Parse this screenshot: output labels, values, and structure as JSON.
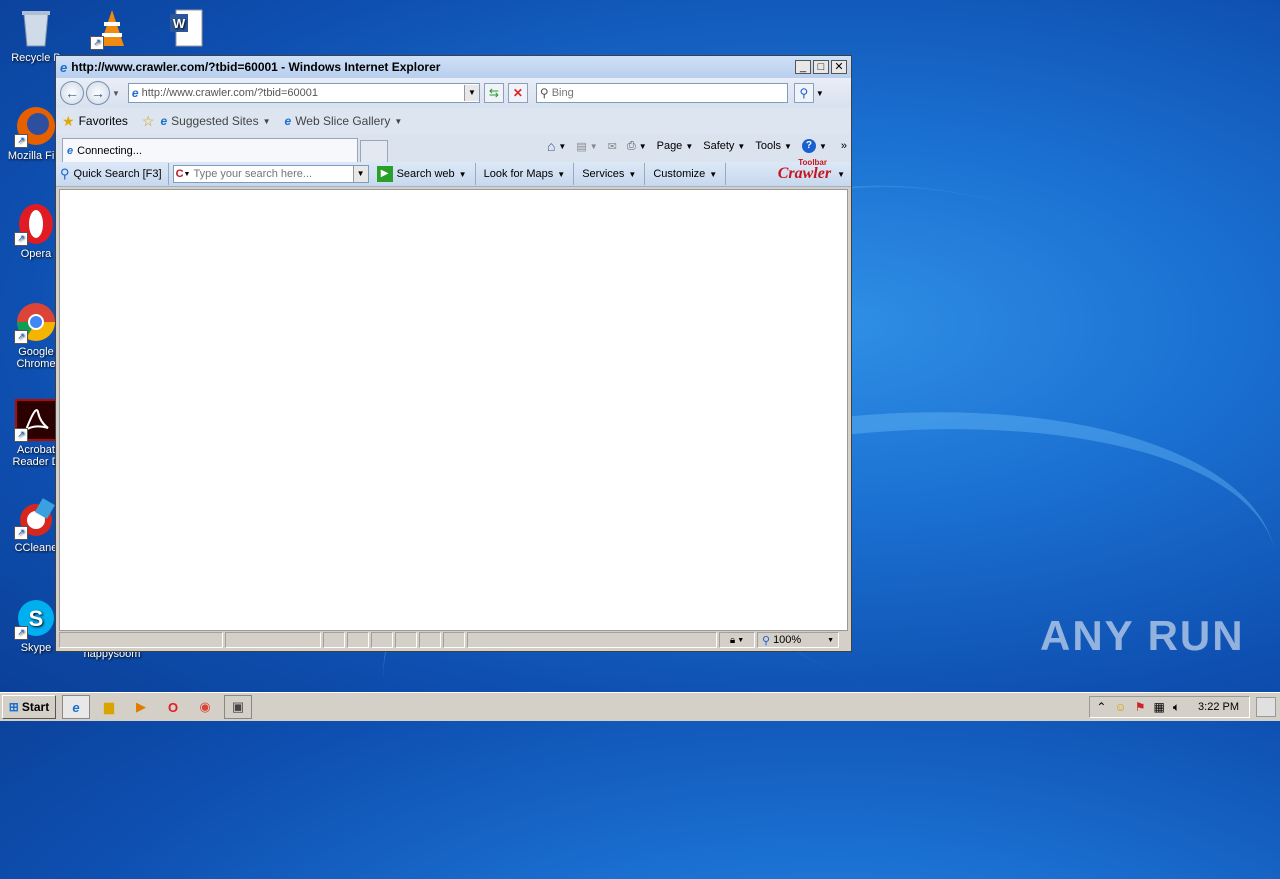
{
  "colors": {
    "accent": "#1a6fd0",
    "window_chrome": "#d4d0c8",
    "crawler_red": "#c4161c"
  },
  "desktop": {
    "icons": [
      {
        "label": "Recycle B",
        "icon": "recycle-bin-icon"
      },
      {
        "label": "Mozilla Fire",
        "icon": "firefox-icon"
      },
      {
        "label": "Opera",
        "icon": "opera-icon"
      },
      {
        "label": "Google Chrome",
        "icon": "chrome-icon"
      },
      {
        "label": "Acrobat Reader D",
        "icon": "acrobat-icon"
      },
      {
        "label": "CCleane",
        "icon": "ccleaner-icon"
      },
      {
        "label": "Skype",
        "icon": "skype-icon"
      },
      {
        "label": "happysoom",
        "icon": "file-icon"
      }
    ]
  },
  "window": {
    "title": "http://www.crawler.com/?tbid=60001 - Windows Internet Explorer",
    "address": "http://www.crawler.com/?tbid=60001",
    "search_placeholder": "Bing",
    "favorites": {
      "favorites_label": "Favorites",
      "suggested_label": "Suggested Sites",
      "webslice_label": "Web Slice Gallery"
    },
    "tab_label": "Connecting...",
    "commands": {
      "page": "Page",
      "safety": "Safety",
      "tools": "Tools"
    },
    "crawler_toolbar": {
      "quick_search": "Quick Search [F3]",
      "search_placeholder": "Type your search here...",
      "search_web": "Search web",
      "look_for_maps": "Look for Maps",
      "services": "Services",
      "customize": "Customize",
      "brand": "Crawler",
      "brand_sup": "Toolbar"
    },
    "status": {
      "zoom": "100%"
    }
  },
  "taskbar": {
    "start_label": "Start",
    "clock": "3:22 PM"
  },
  "watermark": "ANY RUN"
}
